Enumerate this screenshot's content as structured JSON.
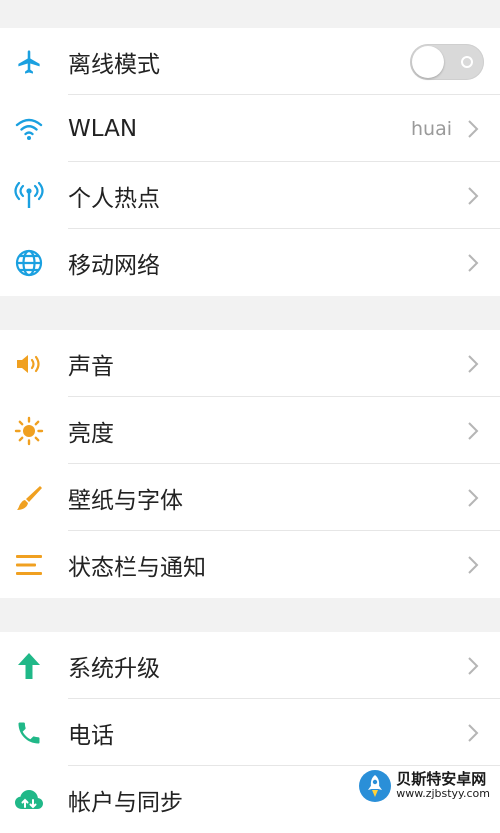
{
  "groups": [
    {
      "items": [
        {
          "label": "离线模式",
          "icon": "airplane-icon",
          "color": "#1aa0e0",
          "control": "toggle",
          "toggle_on": false
        },
        {
          "label": "WLAN",
          "icon": "wifi-icon",
          "color": "#1aa0e0",
          "value": "huai"
        },
        {
          "label": "个人热点",
          "icon": "hotspot-icon",
          "color": "#1aa0e0"
        },
        {
          "label": "移动网络",
          "icon": "globe-icon",
          "color": "#1aa0e0"
        }
      ]
    },
    {
      "items": [
        {
          "label": "声音",
          "icon": "speaker-icon",
          "color": "#f0a020"
        },
        {
          "label": "亮度",
          "icon": "sun-icon",
          "color": "#f0a020"
        },
        {
          "label": "壁纸与字体",
          "icon": "brush-icon",
          "color": "#f0a020"
        },
        {
          "label": "状态栏与通知",
          "icon": "list-icon",
          "color": "#f0a020"
        }
      ]
    },
    {
      "items": [
        {
          "label": "系统升级",
          "icon": "arrow-up-icon",
          "color": "#20b888"
        },
        {
          "label": "电话",
          "icon": "phone-icon",
          "color": "#20b888"
        },
        {
          "label": "帐户与同步",
          "icon": "cloud-sync-icon",
          "color": "#20b888"
        }
      ]
    }
  ],
  "watermark": {
    "title": "贝斯特安卓网",
    "url": "www.zjbstyy.com",
    "logo_icon": "rocket-logo-icon"
  }
}
